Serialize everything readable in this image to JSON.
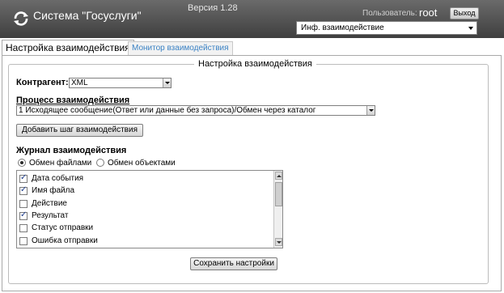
{
  "header": {
    "app_title": "Система \"Госуслуги\"",
    "version": "Версия 1.28",
    "user_label": "Пользователь:",
    "user_name": "root",
    "logout_label": "Выход",
    "module_select_value": "Инф. взаимодействие"
  },
  "tabs": [
    {
      "label": "Настройка взаимодействия",
      "active": true
    },
    {
      "label": "Монитор взаимодействия",
      "active": false
    }
  ],
  "main": {
    "fieldset_legend": "Настройка взаимодействия",
    "counterparty_label": "Контрагент:",
    "counterparty_value": "XML",
    "process_label": "Процесс взаимодействия",
    "process_value": "1 Исходящее сообщение(Ответ или данные без запроса)/Обмен через каталог",
    "add_step_label": "Добавить шаг взаимодействия",
    "journal_label": "Журнал взаимодействия",
    "radio_files_label": "Обмен файлами",
    "radio_objects_label": "Обмен объектами",
    "radio_selected": "files",
    "journal_items": [
      {
        "label": "Дата события",
        "checked": true
      },
      {
        "label": "Имя файла",
        "checked": true
      },
      {
        "label": "Действие",
        "checked": false
      },
      {
        "label": "Результат",
        "checked": true
      },
      {
        "label": "Статус отправки",
        "checked": false
      },
      {
        "label": "Ошибка отправки",
        "checked": false
      }
    ],
    "save_label": "Сохранить настройки"
  },
  "colors": {
    "header_bg": "#555555",
    "tab_link": "#3b82c4"
  }
}
